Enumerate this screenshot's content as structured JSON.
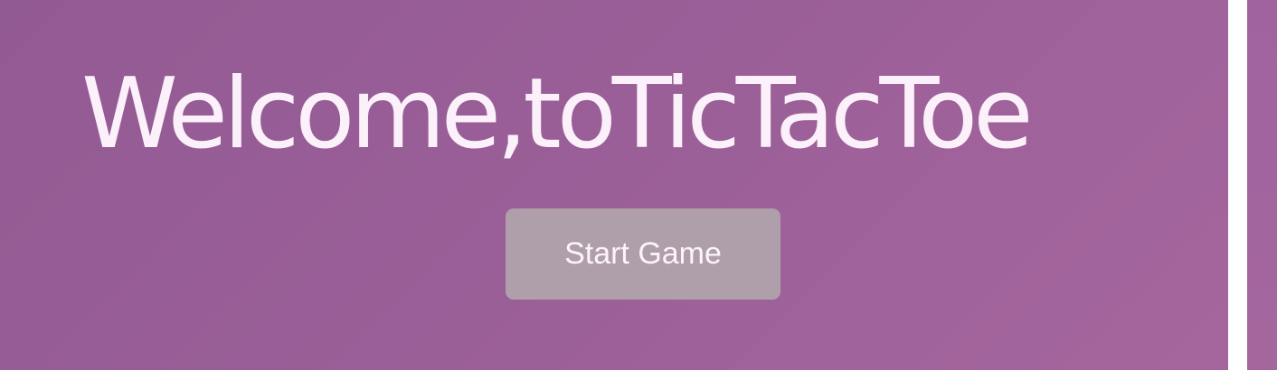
{
  "screen": {
    "title": "Welcome,toTicTacToe",
    "start_button_label": "Start Game"
  },
  "colors": {
    "background": "#9b5f98",
    "title_text": "#fcf1fa",
    "button_background": "#ae9fab",
    "button_text": "#fdf4fb"
  }
}
